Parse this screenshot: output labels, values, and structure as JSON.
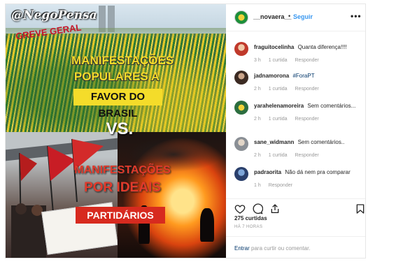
{
  "image": {
    "watermark": "@NegoPensa",
    "top_title_line1": "MANIFESTAÇÕES",
    "top_title_line2": "POPULARES A",
    "top_title_band": "FAVOR DO BRASIL",
    "vs": "VS.",
    "bottom_title_line1": "MANIFESTAÇÕES",
    "bottom_title_line2": "POR IDEAIS",
    "bottom_title_band": "PARTIDÁRIOS",
    "banner_text": "GREVE GERAL"
  },
  "header": {
    "username": "__novaera__",
    "separator": "•",
    "follow_label": "Seguir",
    "more_icon": "ellipsis-icon"
  },
  "comments": [
    {
      "user": "fraguitocelinha",
      "text": "Quanta diferença!!!!",
      "age": "3 h",
      "likes": "1 curtida",
      "reply": "Responder",
      "avatar_color": "#c0392b"
    },
    {
      "user": "jadnamorona",
      "text": "#ForaPT",
      "age": "2 h",
      "likes": "1 curtida",
      "reply": "Responder",
      "avatar_color": "#3b2a22",
      "is_tag": true
    },
    {
      "user": "yarahelenamoreira",
      "text": "Sem comentários...",
      "age": "2 h",
      "likes": "1 curtida",
      "reply": "Responder",
      "avatar_color": "#2c6e3f"
    },
    {
      "user": "sane_widmann",
      "text": "Sem comentários..",
      "age": "2 h",
      "likes": "1 curtida",
      "reply": "Responder",
      "avatar_color": "#8a8f95"
    },
    {
      "user": "padraorita",
      "text": "Não dá nem pra comparar",
      "age": "1 h",
      "reply": "Responder",
      "avatar_color": "#2a3f6b"
    }
  ],
  "actions": {
    "like_icon": "heart-icon",
    "comment_icon": "comment-icon",
    "share_icon": "share-icon",
    "save_icon": "bookmark-icon"
  },
  "likes_count": "275 curtidas",
  "posted": "HÁ 7 HORAS",
  "login_prompt": {
    "link": "Entrar",
    "text": "para curtir ou comentar."
  }
}
